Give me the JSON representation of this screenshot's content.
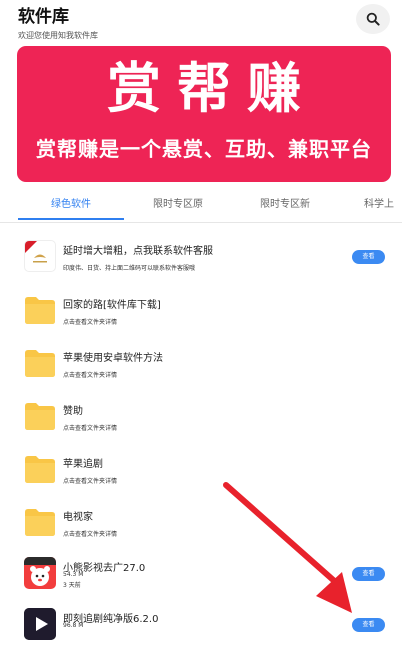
{
  "header": {
    "title": "软件库",
    "subtitle": "欢迎您使用知我软件库"
  },
  "banner": {
    "title": "赏帮赚",
    "slogan": "赏帮赚是一个悬赏、互助、兼职平台",
    "color": "#ee2455"
  },
  "tabs": [
    {
      "label": "绿色软件",
      "active": true
    },
    {
      "label": "限时专区原",
      "active": false
    },
    {
      "label": "限时专区新",
      "active": false
    },
    {
      "label": "科学上",
      "active": false
    }
  ],
  "list": {
    "items": [
      {
        "title": "延时增大增粗，点我联系软件客服",
        "sub": "印度伟、日货、持上面二维码可以联系软件客服哦",
        "icon": "app-store-icon",
        "button": "查看"
      },
      {
        "title": "回家的路[软件库下载]",
        "sub": "点击查看文件夹详情",
        "icon": "folder-icon"
      },
      {
        "title": "苹果使用安卓软件方法",
        "sub": "点击查看文件夹详情",
        "icon": "folder-icon"
      },
      {
        "title": "赞助",
        "sub": "点击查看文件夹详情",
        "icon": "folder-icon"
      },
      {
        "title": "苹果追剧",
        "sub": "点击查看文件夹详情",
        "icon": "folder-icon"
      },
      {
        "title": "电视家",
        "sub": "点击查看文件夹详情",
        "icon": "folder-icon"
      },
      {
        "title": "小熊影视去广27.0",
        "size": "54.3 M",
        "sub": "3 天前",
        "icon": "bear-app-icon",
        "button": "查看"
      },
      {
        "title": "即刻追剧纯净版6.2.0",
        "size": "96.8 M",
        "icon": "play-app-icon",
        "button": "查看"
      }
    ]
  },
  "colors": {
    "accent": "#2f7ff0",
    "folder": "#f9c646",
    "arrow": "#e8222c"
  }
}
